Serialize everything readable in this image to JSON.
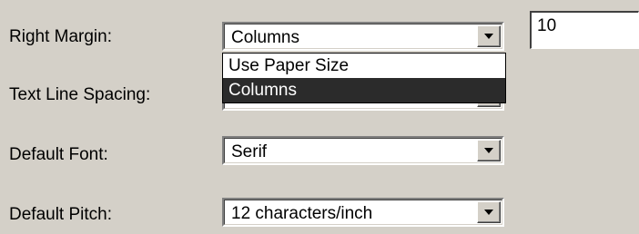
{
  "fields": [
    {
      "label": "Right Margin:",
      "value": "Columns"
    },
    {
      "label": "Text Line Spacing:",
      "value": ""
    },
    {
      "label": "Default Font:",
      "value": "Serif"
    },
    {
      "label": "Default Pitch:",
      "value": "12 characters/inch"
    }
  ],
  "right_margin_number": "10",
  "dropdown": {
    "options": [
      "Use Paper Size",
      "Columns"
    ],
    "selected": "Columns"
  },
  "icons": {
    "combo_arrow": "chevron-down-icon"
  }
}
